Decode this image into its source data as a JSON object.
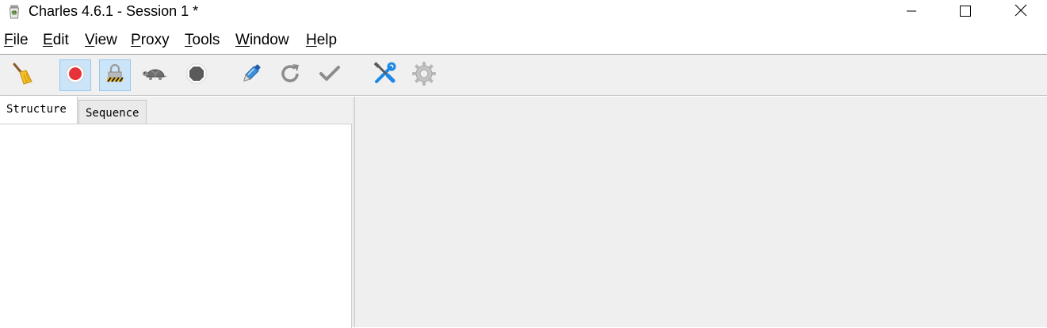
{
  "window": {
    "title": "Charles 4.6.1 - Session 1 *",
    "app_icon": "charles-jar-icon",
    "controls": [
      "minimize-icon",
      "maximize-icon",
      "close-icon"
    ]
  },
  "menu": [
    {
      "mnemonic": "F",
      "rest": "ile"
    },
    {
      "mnemonic": "E",
      "rest": "dit"
    },
    {
      "mnemonic": "V",
      "rest": "iew"
    },
    {
      "mnemonic": "P",
      "rest": "roxy"
    },
    {
      "mnemonic": "T",
      "rest": "ools"
    },
    {
      "mnemonic": "W",
      "rest": "indow"
    },
    {
      "mnemonic": "H",
      "rest": "elp"
    }
  ],
  "toolbar": {
    "buttons": [
      {
        "icon": "broom-icon",
        "pressed": false
      },
      {
        "icon": "record-icon",
        "pressed": true
      },
      {
        "icon": "ssl-proxying-icon",
        "pressed": true
      },
      {
        "icon": "throttle-turtle-icon",
        "pressed": false
      },
      {
        "icon": "breakpoints-hexagon-icon",
        "pressed": false
      },
      {
        "icon": "compose-pen-icon",
        "pressed": false
      },
      {
        "icon": "repeat-icon",
        "pressed": false
      },
      {
        "icon": "validate-check-icon",
        "pressed": false
      },
      {
        "icon": "tools-icon",
        "pressed": false
      },
      {
        "icon": "settings-gear-icon",
        "pressed": false
      }
    ]
  },
  "left_pane": {
    "tabs": [
      {
        "label": "Structure",
        "active": true
      },
      {
        "label": "Sequence",
        "active": false
      }
    ]
  },
  "colors": {
    "toolbar_bg": "#f0f0f0",
    "pressed_bg": "#cce4f7",
    "record_red": "#e8323a",
    "tools_blue": "#1e88e5"
  }
}
